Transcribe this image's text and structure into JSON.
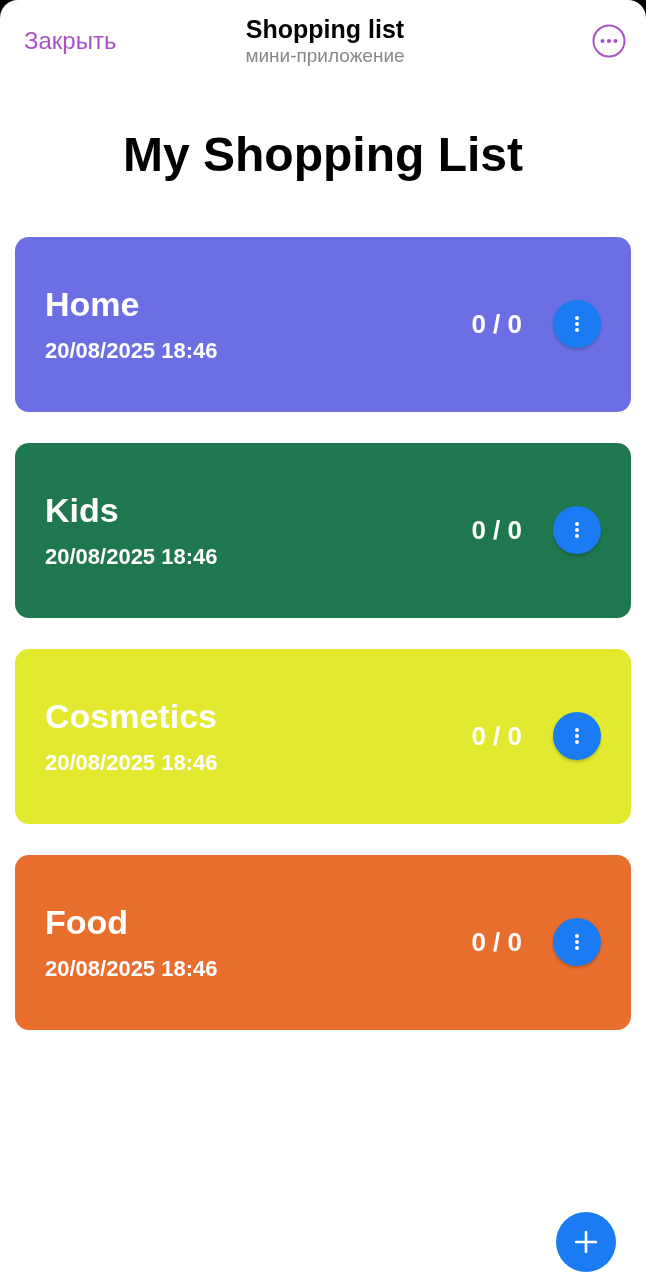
{
  "header": {
    "close": "Закрыть",
    "title": "Shopping list",
    "subtitle": "мини-приложение"
  },
  "heading": "My Shopping List",
  "lists": [
    {
      "name": "Home",
      "date": "20/08/2025 18:46",
      "count": "0 / 0",
      "color": "#6c6fe3"
    },
    {
      "name": "Kids",
      "date": "20/08/2025 18:46",
      "count": "0 / 0",
      "color": "#1e774f"
    },
    {
      "name": "Cosmetics",
      "date": "20/08/2025 18:46",
      "count": "0 / 0",
      "color": "#e2e92e"
    },
    {
      "name": "Food",
      "date": "20/08/2025 18:46",
      "count": "0 / 0",
      "color": "#e86e2e"
    }
  ]
}
